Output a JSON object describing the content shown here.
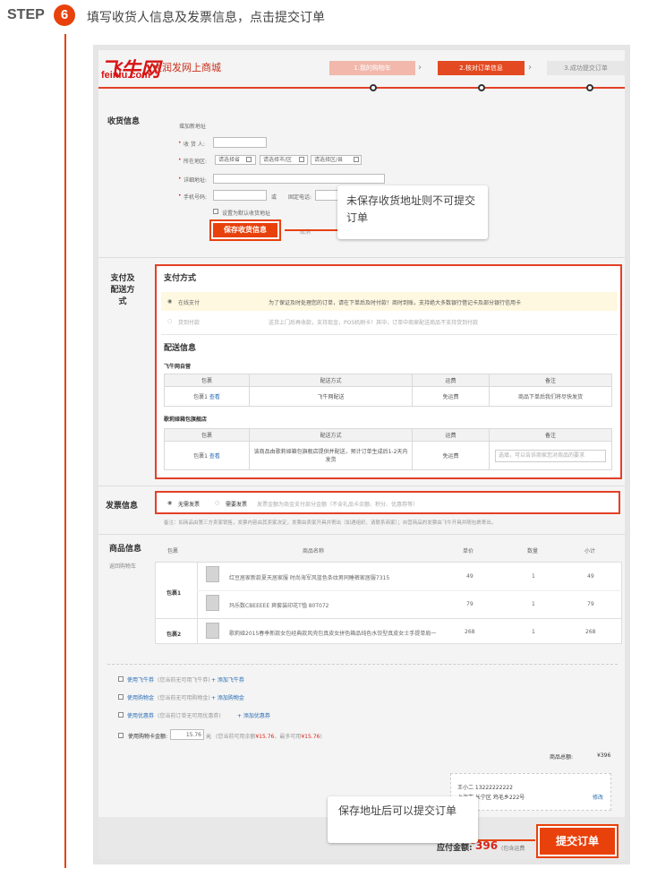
{
  "step": {
    "word": "STEP",
    "number": "6",
    "text": "填写收货人信息及发票信息，点击提交订单"
  },
  "header": {
    "logo": "飞牛网",
    "logo_sub": "feiniu.com",
    "site_name": "大润发网上商城",
    "progress": [
      "1.我的购物车",
      "2.核对订单信息",
      "3.成功提交订单"
    ],
    "arrow": "›"
  },
  "address": {
    "section": "收货信息",
    "add_new": "增加新地址",
    "name_label": "收 货 人:",
    "region_label": "所在地区:",
    "province": "请选择省",
    "city": "请选择市/区",
    "district": "请选择区/县",
    "detail_label": "详细地址:",
    "mobile_label": "手机号码:",
    "or": "或",
    "phone_label": "固定电话:",
    "default_label": "设置为默认收货地址",
    "save_button": "保存收货信息",
    "cancel": "取消",
    "required": "•"
  },
  "tip_top": "未保存收货地址则不可提交订单",
  "payment": {
    "section_line1": "支付及",
    "section_line2": "配送方式",
    "title": "支付方式",
    "options": [
      {
        "label": "在线支付",
        "desc": "为了保证及时处理您的订单，请在下单后及时付款！商时到账，支持绝大多数银行借记卡及部分银行信用卡"
      },
      {
        "label": "货到付款",
        "desc": "送货上门后再收款，支持现金，POS机刷卡！其中，订单中商家配送商品不支持货到付款"
      }
    ]
  },
  "delivery": {
    "title": "配送信息",
    "store1": "飞牛网自营",
    "headers": [
      "包裹",
      "配送方式",
      "运费",
      "备注"
    ],
    "row1": {
      "pkg": "包裹1",
      "view": "查看",
      "method": "飞牛网配送",
      "fee": "免运费",
      "note": "商品下单后我们将尽快发货"
    },
    "store2": "歌莉娅箱包旗舰店",
    "row2": {
      "pkg": "包裹1",
      "view": "查看",
      "method": "该商品由歌莉娅箱包旗舰店提供并配送，预计订单生成后1-2天内发货",
      "fee": "免运费",
      "note_placeholder": "选填，可以告诉商家您对商品的要求"
    }
  },
  "invoice": {
    "section": "发票信息",
    "opt1": "无需发票",
    "opt2": "需要发票",
    "desc": "发票金额为商金支付部分金额（不含礼品卡余额、积分、优惠券等）",
    "note": "备注：如商品由第三方卖家销售，发票内容由其卖家决定，发票由卖家开具并寄出（如遇组织、请联系商家）；自营商品的发票由飞牛开具并随包裹寄出。"
  },
  "products": {
    "section": "商品信息",
    "back": "返回购物车",
    "headers": [
      "包裹",
      "商品名称",
      "单价",
      "数量",
      "小计"
    ],
    "groups": [
      {
        "pkg": "包裹1",
        "items": [
          {
            "name": "红豆居家新款夏天居家服 时尚海军风蓝色条纹男同睡裤家居服7315",
            "price": "49",
            "qty": "1",
            "subtotal": "49"
          },
          {
            "name": "玛乐数CBEEEEE 爽套装印花T恤 80T072",
            "price": "79",
            "qty": "1",
            "subtotal": "79"
          }
        ]
      },
      {
        "pkg": "包裹2",
        "items": [
          {
            "name": "歌莉娅2015春季新款女包经典款风壳包真皮女拼色箱品纯色水饺型真皮女士手提单肩一",
            "price": "268",
            "qty": "1",
            "subtotal": "268"
          }
        ]
      }
    ]
  },
  "discounts": {
    "items": [
      {
        "label": "使用飞牛券",
        "gray": "(您当前无可用飞牛券)",
        "link": "+ 添加飞牛券"
      },
      {
        "label": "使用购物金",
        "gray": "(您当前无可用购物金)",
        "link": "+ 添加购物金"
      },
      {
        "label": "使用优惠券",
        "gray": "(您当前订单无可用优惠券)",
        "link": "+ 添加优惠券"
      }
    ],
    "card_label": "使用购物卡金额:",
    "card_value": "15.76",
    "yuan": "元",
    "card_note": "(您当前可用余额",
    "card_amt1": "¥15.76",
    "card_mid": "，最多可用",
    "card_amt2": "¥15.76",
    "card_end": ")"
  },
  "totals": {
    "label": "商品总额:",
    "value": "¥396"
  },
  "consignee": {
    "name": "王小二 13222222222",
    "addr": "上海市 长宁区 鸡毛乡222号",
    "modify": "修改"
  },
  "footer": {
    "total_label": "应付金额:",
    "total_value": "396",
    "total_note": "(包含运费",
    "submit": "提交订单"
  },
  "tip_bottom": "保存地址后可以提交订单"
}
